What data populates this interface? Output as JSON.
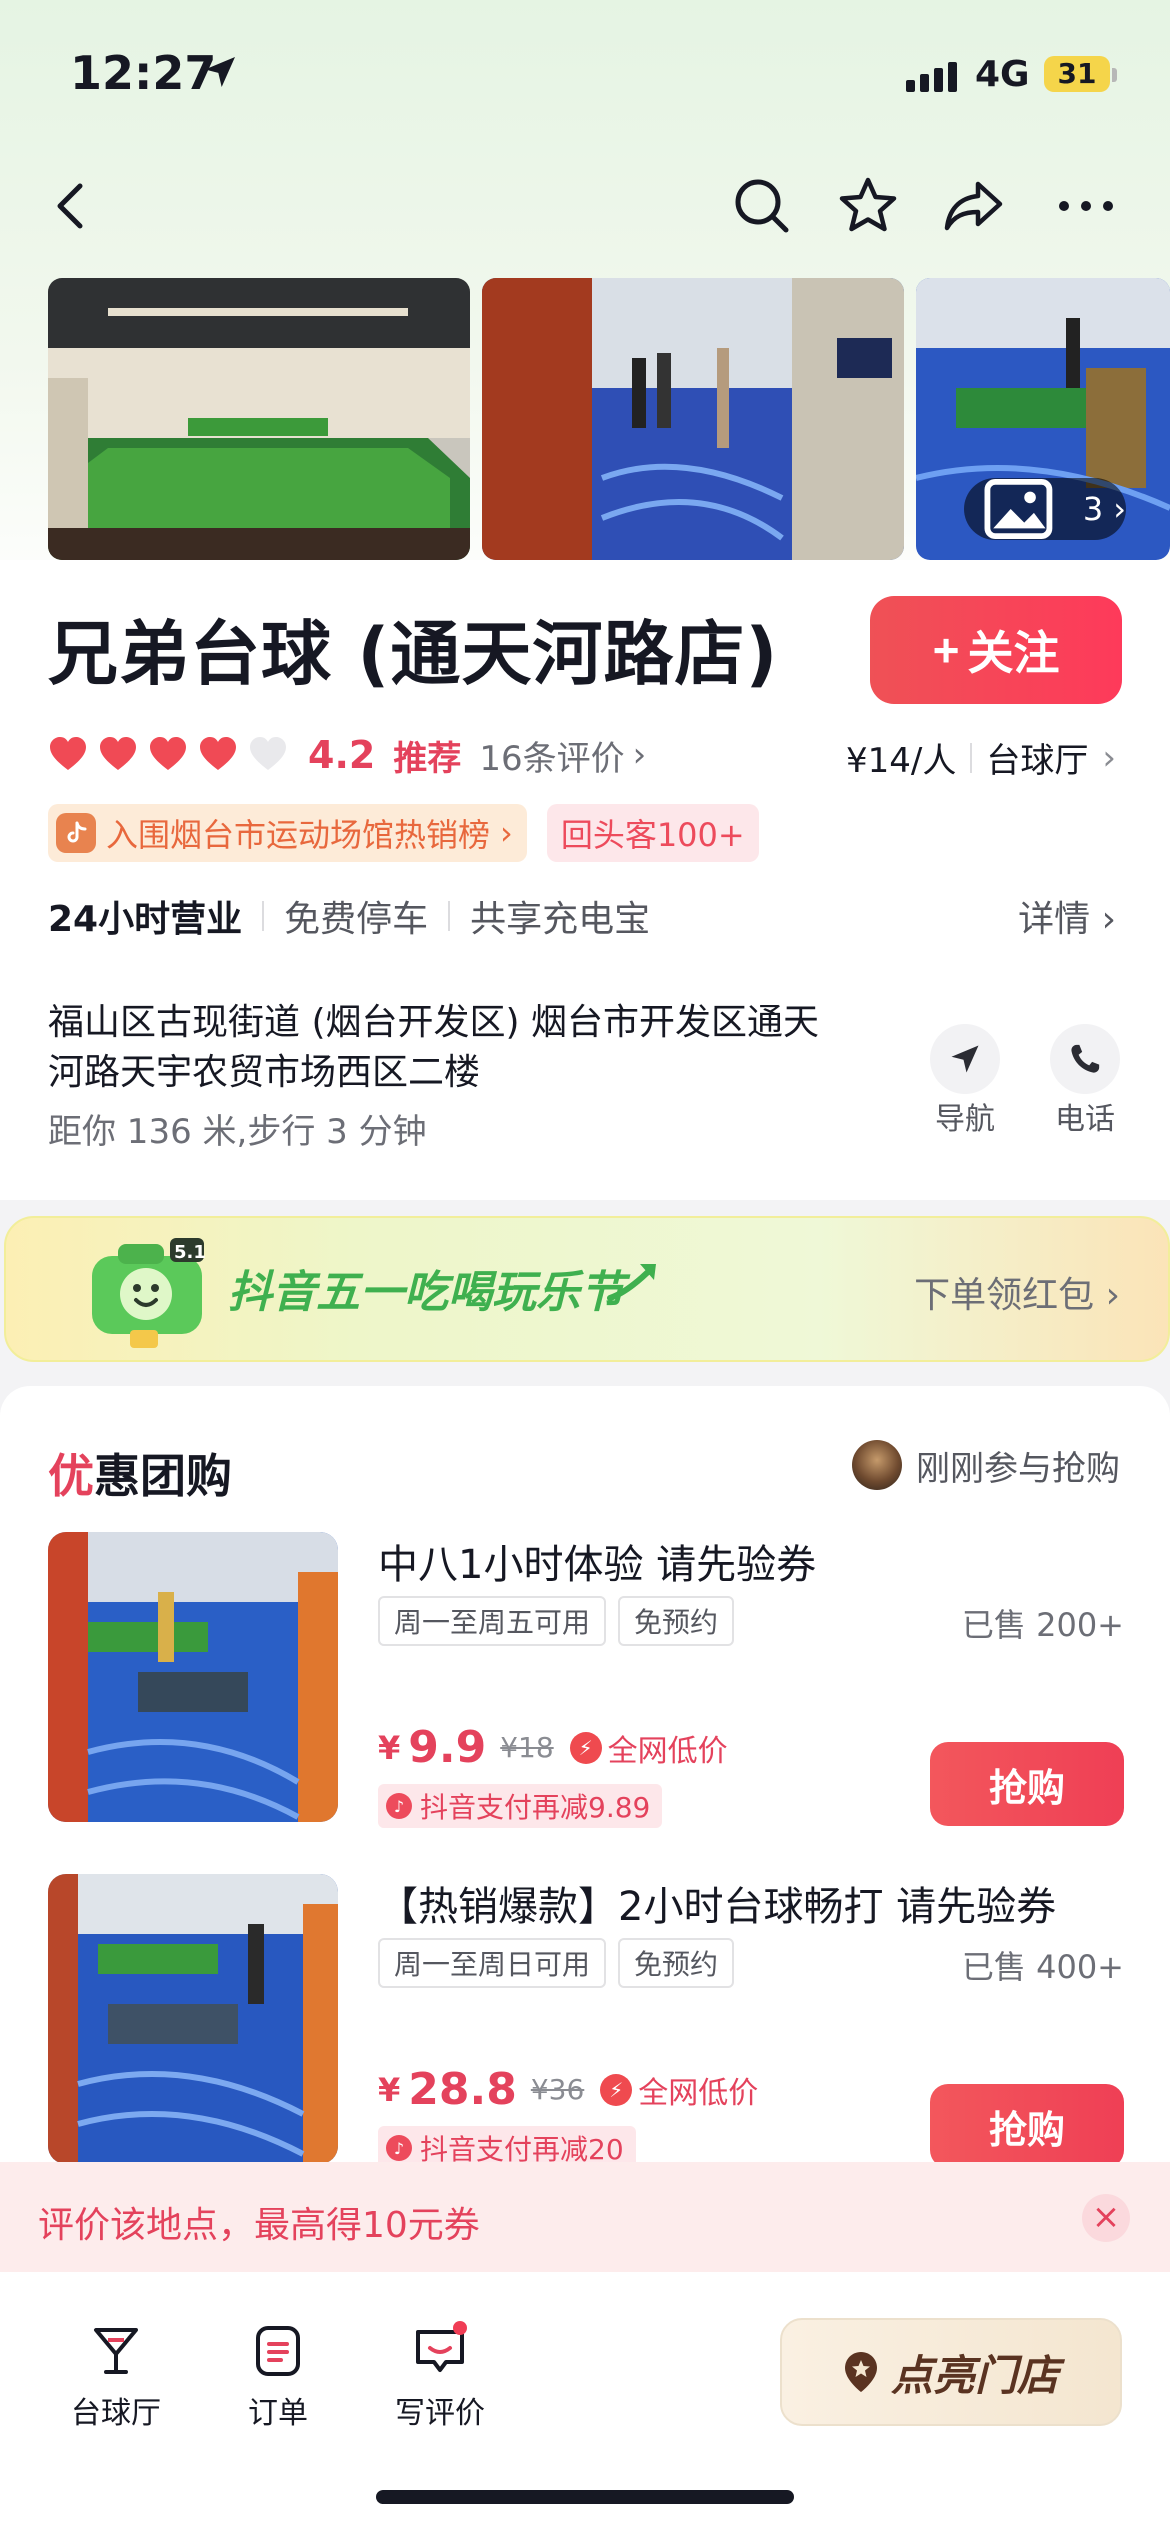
{
  "status_bar": {
    "time": "12:27",
    "network": "4G",
    "battery": "31"
  },
  "nav": {
    "icons": [
      "back-icon",
      "search-icon",
      "star-icon",
      "share-icon",
      "more-icon"
    ]
  },
  "gallery": {
    "photo_count": "3"
  },
  "shop": {
    "name": "兄弟台球 (通天河路店)",
    "follow_label": "关注",
    "rating": "4.2",
    "recommend": "推荐",
    "reviews": "16条评价",
    "price_per_person": "¥14/人",
    "category": "台球厅",
    "rank_badge": "入围烟台市运动场馆热销榜",
    "return_badge": "回头客100+",
    "facilities": [
      "24小时营业",
      "免费停车",
      "共享充电宝"
    ],
    "details_label": "详情",
    "address": "福山区古现街道 (烟台开发区) 烟台市开发区通天河路天宇农贸市场西区二楼",
    "distance": "距你 136 米,步行 3 分钟",
    "navigate_label": "导航",
    "phone_label": "电话"
  },
  "banner": {
    "title": "抖音五一吃喝玩乐节",
    "cta": "下单领红包",
    "badge": "5.1"
  },
  "deals": {
    "title_first": "优",
    "title_rest": "惠团购",
    "recent_text": "刚刚参与抢购",
    "items": [
      {
        "name": "中八1小时体验 请先验券",
        "tags": [
          "周一至周五可用",
          "免预约"
        ],
        "sold": "已售 200+",
        "currency": "¥",
        "price": "9.9",
        "original": "¥18",
        "lowest": "全网低价",
        "pay_discount": "抖音支付再减9.89",
        "buy_label": "抢购"
      },
      {
        "name": "【热销爆款】2小时台球畅打 请先验券",
        "tags": [
          "周一至周日可用",
          "免预约"
        ],
        "sold": "已售 400+",
        "currency": "¥",
        "price": "28.8",
        "original": "¥36",
        "lowest": "全网低价",
        "pay_discount": "抖音支付再减20",
        "buy_label": "抢购"
      }
    ]
  },
  "prompt": {
    "text": "评价该地点，最高得10元券",
    "close": "×"
  },
  "bottom_bar": {
    "tabs": [
      {
        "label": "台球厅",
        "icon": "cocktail-icon"
      },
      {
        "label": "订单",
        "icon": "order-icon"
      },
      {
        "label": "写评价",
        "icon": "review-icon"
      }
    ],
    "light_up_label": "点亮门店"
  },
  "colors": {
    "accent": "#e4425c",
    "follow": "#ef5156",
    "green": "#3fb04f"
  }
}
